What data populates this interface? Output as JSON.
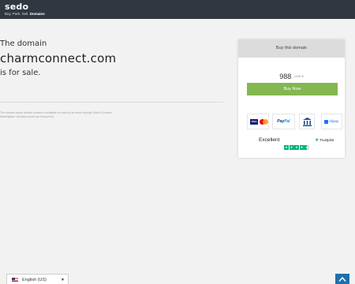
{
  "header": {
    "logo": "sedo",
    "tagline_prefix": "Buy. Park. Sell.",
    "tagline_bold": "Domains"
  },
  "main": {
    "intro": "The domain",
    "domain": "charmconnect.com",
    "for_sale": "is for sale.",
    "disclaimer": "The domain owner defines content is available for sale by its owner through Sedo's Domain Marketplace. All listed prices are final prices."
  },
  "card": {
    "title": "Buy this domain",
    "price": "988",
    "currency": "USD",
    "buy_label": "Buy Now",
    "payments": {
      "visa": "VISA",
      "paypal_a": "Pay",
      "paypal_b": "Pal",
      "alipay": "Alipay"
    },
    "rating_label": "Excellent",
    "trustpilot": "Trustpilot",
    "rating_stars": 4.5
  },
  "footer": {
    "language": "English (US)"
  },
  "colors": {
    "header_bg": "#313741",
    "buy_button": "#83b750",
    "scroll_top": "#1f6fae",
    "trustpilot_green": "#00b67a"
  }
}
